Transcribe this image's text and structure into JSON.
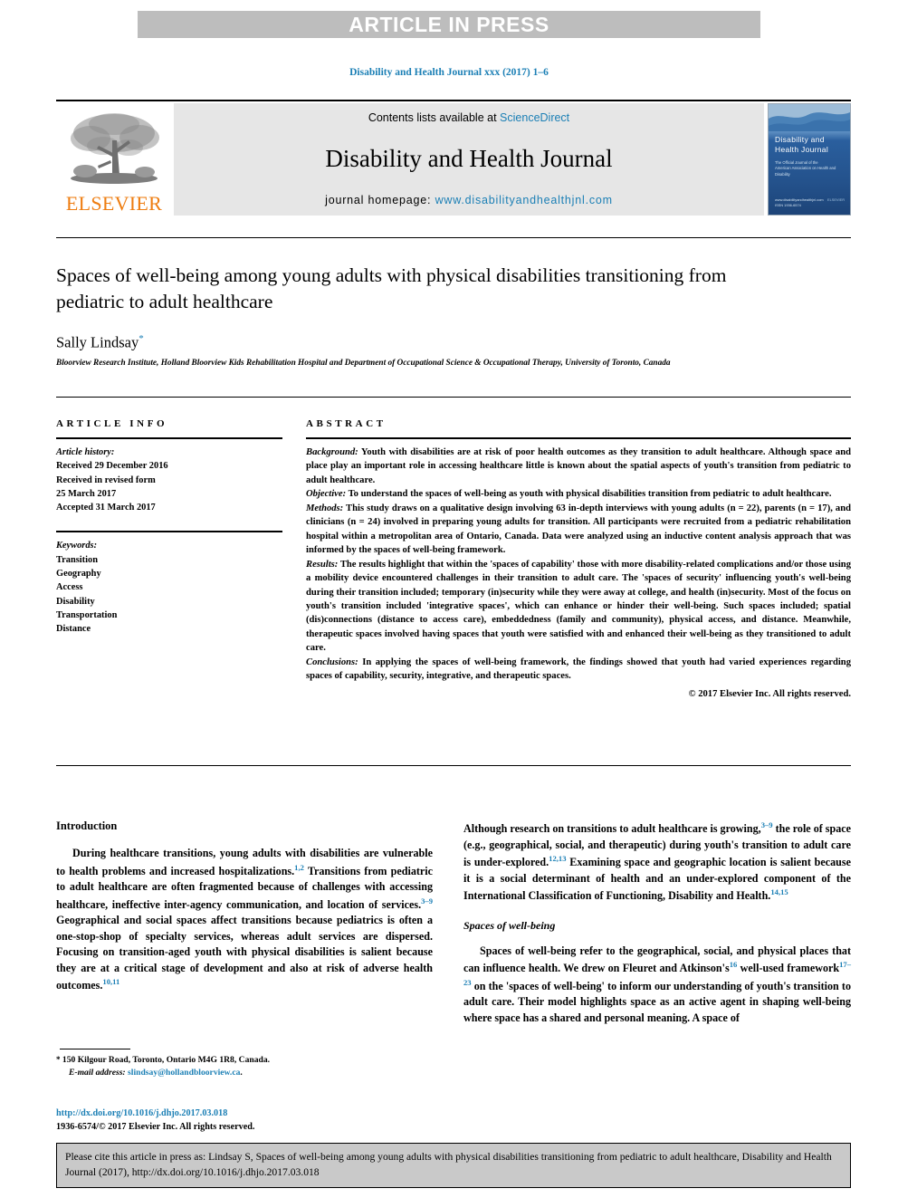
{
  "banner": {
    "text": "ARTICLE IN PRESS"
  },
  "journal_ref": "Disability and Health Journal xxx (2017) 1–6",
  "masthead": {
    "contents_label": "Contents lists available at",
    "sciencedirect": "ScienceDirect",
    "journal_title": "Disability and Health Journal",
    "homepage_label": "journal homepage:",
    "homepage_url": "www.disabilityandhealthjnl.com",
    "publisher": "ELSEVIER",
    "cover": {
      "title": "Disability and\nHealth Journal",
      "subtitle": "The Official Journal of the\nAmerican Association on Health and Disability",
      "footer_left": "www.disabilityandhealthjnl.com",
      "footer_right": "ELSEVIER",
      "issn_line": "ISSN 1936-6574"
    }
  },
  "article": {
    "title": "Spaces of well-being among young adults with physical disabilities transitioning from pediatric to adult healthcare",
    "author": "Sally Lindsay",
    "author_marker": "*",
    "affiliation": "Bloorview Research Institute, Holland Bloorview Kids Rehabilitation Hospital and Department of Occupational Science & Occupational Therapy, University of Toronto, Canada"
  },
  "article_info": {
    "heading": "ARTICLE INFO",
    "history_label": "Article history:",
    "history": [
      "Received 29 December 2016",
      "Received in revised form",
      "25 March 2017",
      "Accepted 31 March 2017"
    ],
    "keywords_label": "Keywords:",
    "keywords": [
      "Transition",
      "Geography",
      "Access",
      "Disability",
      "Transportation",
      "Distance"
    ]
  },
  "abstract": {
    "heading": "ABSTRACT",
    "sections": [
      {
        "label": "Background:",
        "text": " Youth with disabilities are at risk of poor health outcomes as they transition to adult healthcare. Although space and place play an important role in accessing healthcare little is known about the spatial aspects of youth's transition from pediatric to adult healthcare."
      },
      {
        "label": "Objective:",
        "text": " To understand the spaces of well-being as youth with physical disabilities transition from pediatric to adult healthcare."
      },
      {
        "label": "Methods:",
        "text": " This study draws on a qualitative design involving 63 in-depth interviews with young adults (n = 22), parents (n = 17), and clinicians (n = 24) involved in preparing young adults for transition. All participants were recruited from a pediatric rehabilitation hospital within a metropolitan area of Ontario, Canada. Data were analyzed using an inductive content analysis approach that was informed by the spaces of well-being framework."
      },
      {
        "label": "Results:",
        "text": " The results highlight that within the 'spaces of capability' those with more disability-related complications and/or those using a mobility device encountered challenges in their transition to adult care. The 'spaces of security' influencing youth's well-being during their transition included; temporary (in)security while they were away at college, and health (in)security. Most of the focus on youth's transition included 'integrative spaces', which can enhance or hinder their well-being. Such spaces included; spatial (dis)connections (distance to access care), embeddedness (family and community), physical access, and distance. Meanwhile, therapeutic spaces involved having spaces that youth were satisfied with and enhanced their well-being as they transitioned to adult care."
      },
      {
        "label": "Conclusions:",
        "text": " In applying the spaces of well-being framework, the findings showed that youth had varied experiences regarding spaces of capability, security, integrative, and therapeutic spaces."
      }
    ],
    "copyright": "© 2017 Elsevier Inc. All rights reserved."
  },
  "body": {
    "intro_heading": "Introduction",
    "intro_p1_a": "During healthcare transitions, young adults with disabilities are vulnerable to health problems and increased hospitalizations.",
    "intro_p1_cite1": "1,2",
    "intro_p1_b": " Transitions from pediatric to adult healthcare are often fragmented because of challenges with accessing healthcare, ineffective inter-agency communication, and location of services.",
    "intro_p1_cite2": "3–9",
    "intro_p1_c": " Geographical and social spaces affect transitions because pediatrics is often a one-stop-shop of specialty services, whereas adult services are dispersed. Focusing on transition-aged youth with physical disabilities is salient because they are at a critical stage of development and also at risk of adverse health outcomes.",
    "intro_p1_cite3": "10,11",
    "right_p1_a": "Although research on transitions to adult healthcare is growing,",
    "right_p1_cite1": "3–9",
    "right_p1_b": " the role of space (e.g., geographical, social, and therapeutic) during youth's transition to adult care is under-explored.",
    "right_p1_cite2": "12,13",
    "right_p1_c": " Examining space and geographic location is salient because it is a social determinant of health and an under-explored component of the International Classification of Functioning, Disability and Health.",
    "right_p1_cite3": "14,15",
    "sub_heading": "Spaces of well-being",
    "right_p2_a": "Spaces of well-being refer to the geographical, social, and physical places that can influence health. We drew on Fleuret and Atkinson's",
    "right_p2_cite1": "16",
    "right_p2_b": " well-used framework",
    "right_p2_cite2": "17–23",
    "right_p2_c": " on the 'spaces of well-being' to inform our understanding of youth's transition to adult care. Their model highlights space as an active agent in shaping well-being where space has a shared and personal meaning. A space of"
  },
  "footnote": {
    "marker": "*",
    "address": "150 Kilgour Road, Toronto, Ontario M4G 1R8, Canada.",
    "email_label": "E-mail address:",
    "email": "slindsay@hollandbloorview.ca",
    "email_suffix": ".",
    "doi": "http://dx.doi.org/10.1016/j.dhjo.2017.03.018",
    "issn_copyright": "1936-6574/© 2017 Elsevier Inc. All rights reserved."
  },
  "cite_box": {
    "text": "Please cite this article in press as: Lindsay S, Spaces of well-being among young adults with physical disabilities transitioning from pediatric to adult healthcare, Disability and Health Journal (2017), http://dx.doi.org/10.1016/j.dhjo.2017.03.018"
  }
}
